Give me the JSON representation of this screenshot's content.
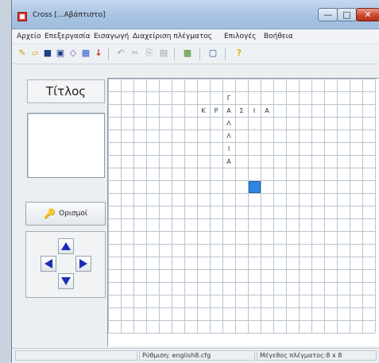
{
  "window": {
    "title": "Cross [...Αβάπτιστο]",
    "minimize_label": "—",
    "maximize_label": "□",
    "close_label": "✕"
  },
  "menu": [
    "Αρχείο",
    "Επεξεργασία",
    "Εισαγωγή",
    "Διαχείριση πλέγματος",
    "Επιλογές",
    "Βοήθεια"
  ],
  "toolbar": {
    "icons": [
      "new-icon",
      "open-icon",
      "save-icon",
      "save-as-icon",
      "eraser-icon",
      "grid-icon",
      "arrow-down-icon",
      "undo-icon",
      "cut-icon",
      "copy-icon",
      "paste-icon",
      "grid-settings-icon",
      "monitor-icon",
      "help-icon"
    ]
  },
  "left_panel": {
    "title_label": "Τίτλος",
    "clue_text": "",
    "define_button_label": "Ορισμοί"
  },
  "grid": {
    "cols": 21,
    "rows": 20,
    "letters": [
      {
        "row": 1,
        "col": 9,
        "ch": "Γ"
      },
      {
        "row": 2,
        "col": 7,
        "ch": "Κ"
      },
      {
        "row": 2,
        "col": 8,
        "ch": "Ρ"
      },
      {
        "row": 2,
        "col": 9,
        "ch": "Α"
      },
      {
        "row": 2,
        "col": 10,
        "ch": "Σ"
      },
      {
        "row": 2,
        "col": 11,
        "ch": "Ι"
      },
      {
        "row": 2,
        "col": 12,
        "ch": "Α"
      },
      {
        "row": 3,
        "col": 9,
        "ch": "Λ"
      },
      {
        "row": 4,
        "col": 9,
        "ch": "Λ"
      },
      {
        "row": 5,
        "col": 9,
        "ch": "Ι"
      },
      {
        "row": 6,
        "col": 9,
        "ch": "Α"
      }
    ],
    "cursor": {
      "row": 8,
      "col": 11
    },
    "cursor_color": "#2f86e0",
    "line_color": "#b9c4cf"
  },
  "status": {
    "settings": "Ρύθμιση: english8.cfg",
    "grid_size": "Μέγεθος πλέγματος:8 x 8"
  }
}
